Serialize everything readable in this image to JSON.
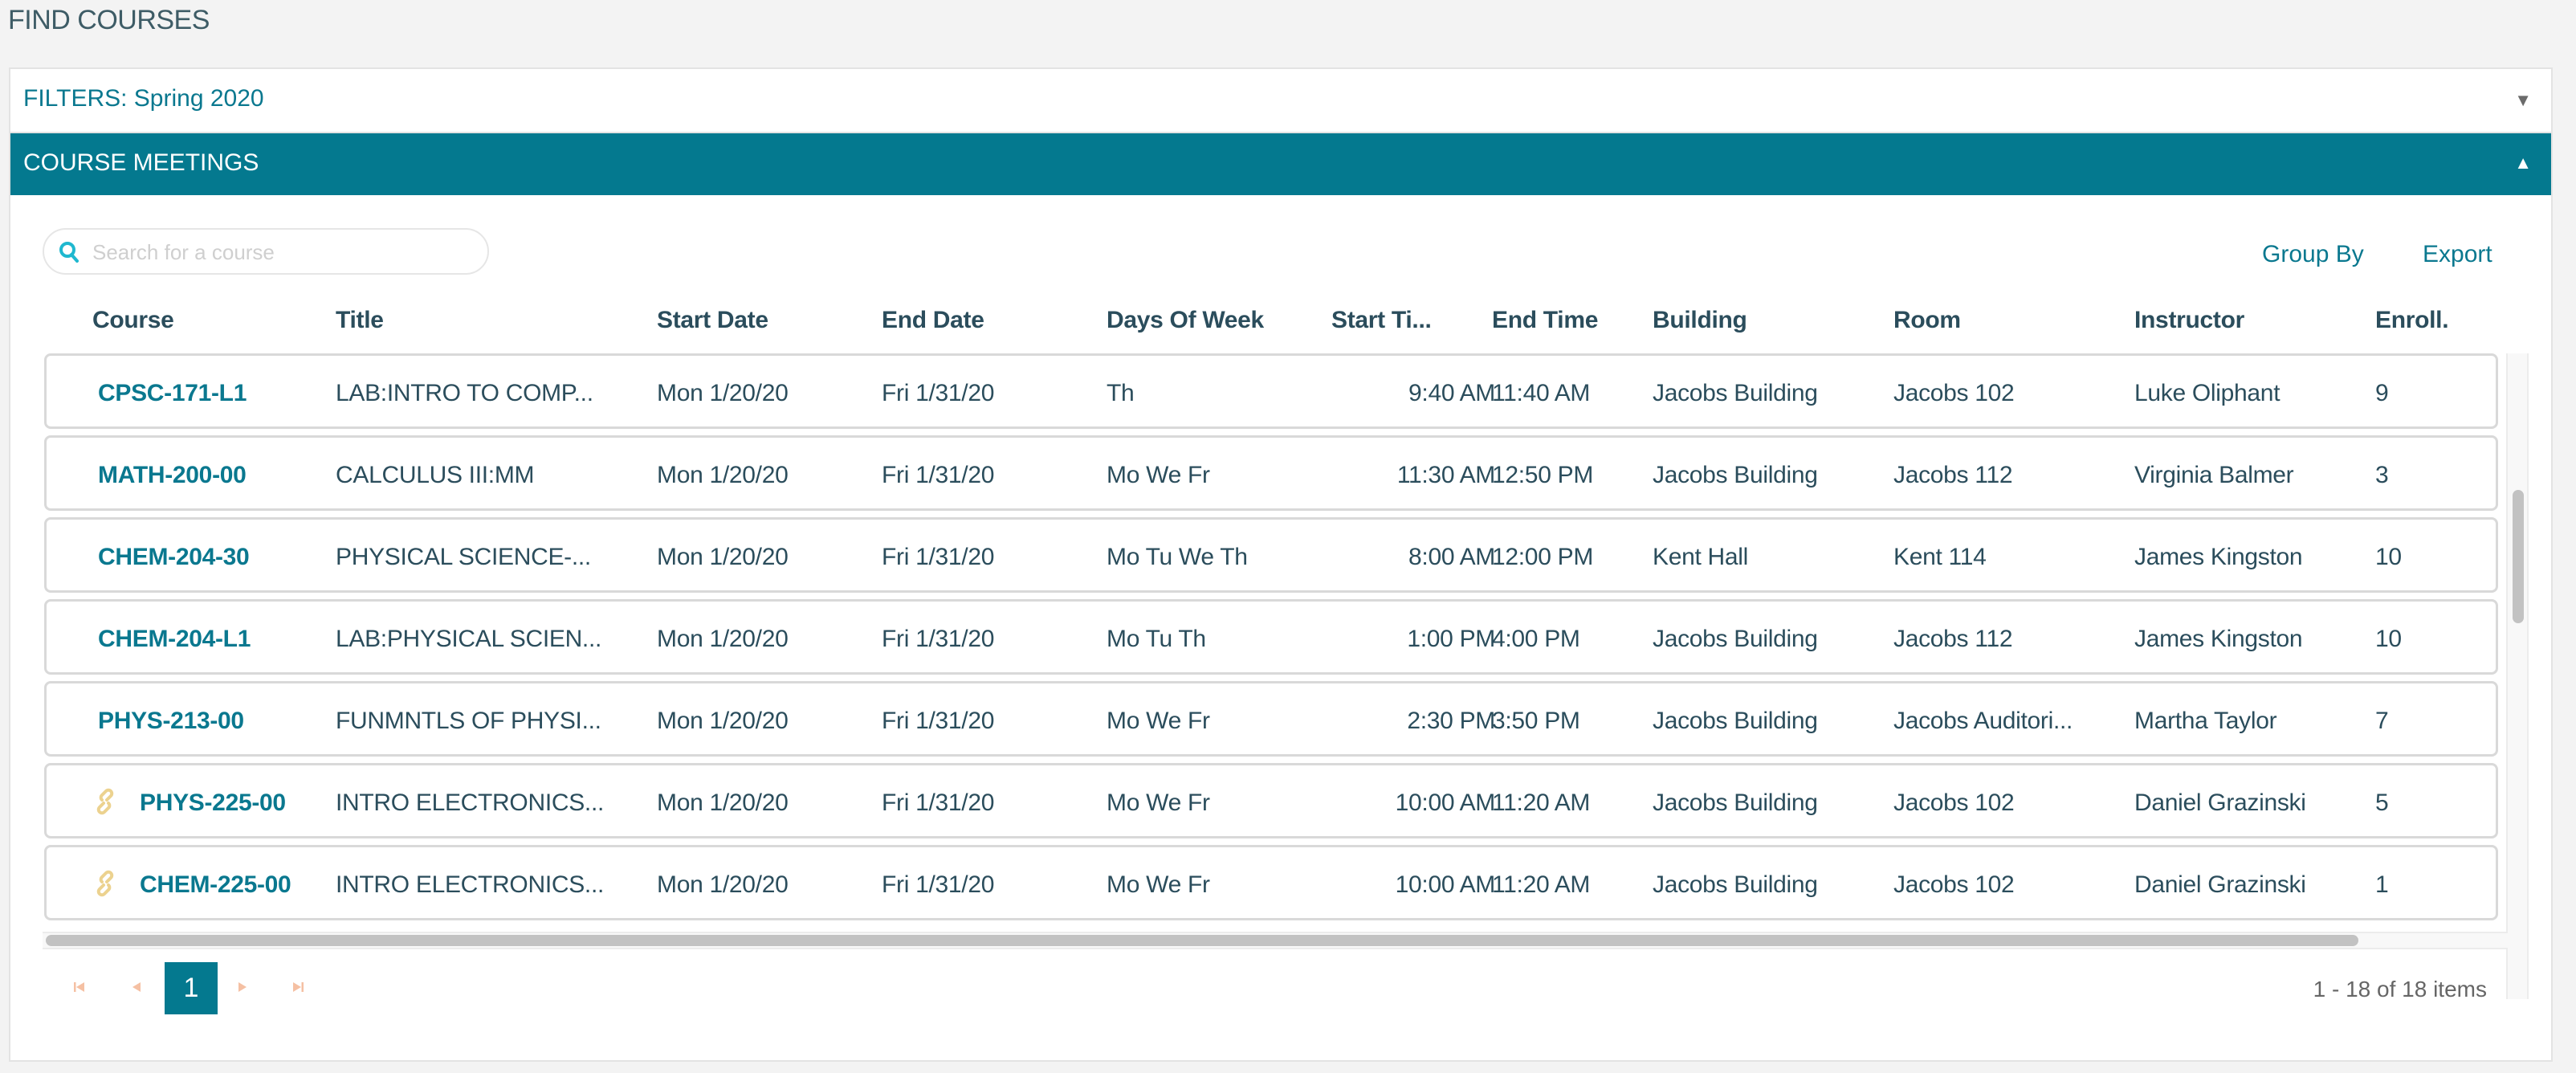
{
  "page": {
    "title": "FIND COURSES"
  },
  "filters": {
    "label": "FILTERS: Spring 2020",
    "icon": "caret-down-icon"
  },
  "meetings": {
    "label": "COURSE MEETINGS",
    "icon": "caret-up-icon"
  },
  "search": {
    "placeholder": "Search for a course",
    "value": "",
    "icon": "search-icon"
  },
  "toolbar": {
    "group_by_label": "Group By",
    "export_label": "Export"
  },
  "colors": {
    "accent": "#04798f",
    "link": "#0a788f",
    "text": "#2b4d5c",
    "linked_icon": "#ecd28f",
    "pager_disabled": "#f5c0a3"
  },
  "columns": [
    "Course",
    "Title",
    "Start Date",
    "End Date",
    "Days Of Week",
    "Start Ti...",
    "End Time",
    "Building",
    "Room",
    "Instructor",
    "Enroll."
  ],
  "rows": [
    {
      "course": "CPSC-171-L1",
      "linked": false,
      "title": "LAB:INTRO TO COMP...",
      "start_date": "Mon 1/20/20",
      "end_date": "Fri 1/31/20",
      "days": "Th",
      "start_time": "9:40 AM",
      "end_time": "11:40 AM",
      "building": "Jacobs Building",
      "room": "Jacobs 102",
      "instructor": "Luke Oliphant",
      "enroll": "9"
    },
    {
      "course": "MATH-200-00",
      "linked": false,
      "title": "CALCULUS III:MM",
      "start_date": "Mon 1/20/20",
      "end_date": "Fri 1/31/20",
      "days": "Mo We Fr",
      "start_time": "11:30 AM",
      "end_time": "12:50 PM",
      "building": "Jacobs Building",
      "room": "Jacobs 112",
      "instructor": "Virginia Balmer",
      "enroll": "3"
    },
    {
      "course": "CHEM-204-30",
      "linked": false,
      "title": "PHYSICAL SCIENCE-...",
      "start_date": "Mon 1/20/20",
      "end_date": "Fri 1/31/20",
      "days": "Mo Tu We Th",
      "start_time": "8:00 AM",
      "end_time": "12:00 PM",
      "building": "Kent Hall",
      "room": "Kent 114",
      "instructor": "James Kingston",
      "enroll": "10"
    },
    {
      "course": "CHEM-204-L1",
      "linked": false,
      "title": "LAB:PHYSICAL SCIEN...",
      "start_date": "Mon 1/20/20",
      "end_date": "Fri 1/31/20",
      "days": "Mo Tu Th",
      "start_time": "1:00 PM",
      "end_time": "4:00 PM",
      "building": "Jacobs Building",
      "room": "Jacobs 112",
      "instructor": "James Kingston",
      "enroll": "10"
    },
    {
      "course": "PHYS-213-00",
      "linked": false,
      "title": "FUNMNTLS OF PHYSI...",
      "start_date": "Mon 1/20/20",
      "end_date": "Fri 1/31/20",
      "days": "Mo We Fr",
      "start_time": "2:30 PM",
      "end_time": "3:50 PM",
      "building": "Jacobs Building",
      "room": "Jacobs Auditori...",
      "instructor": "Martha Taylor",
      "enroll": "7"
    },
    {
      "course": "PHYS-225-00",
      "linked": true,
      "title": "INTRO ELECTRONICS...",
      "start_date": "Mon 1/20/20",
      "end_date": "Fri 1/31/20",
      "days": "Mo We Fr",
      "start_time": "10:00 AM",
      "end_time": "11:20 AM",
      "building": "Jacobs Building",
      "room": "Jacobs 102",
      "instructor": "Daniel Grazinski",
      "enroll": "5"
    },
    {
      "course": "CHEM-225-00",
      "linked": true,
      "title": "INTRO ELECTRONICS...",
      "start_date": "Mon 1/20/20",
      "end_date": "Fri 1/31/20",
      "days": "Mo We Fr",
      "start_time": "10:00 AM",
      "end_time": "11:20 AM",
      "building": "Jacobs Building",
      "room": "Jacobs 102",
      "instructor": "Daniel Grazinski",
      "enroll": "1"
    }
  ],
  "pager": {
    "current_page": "1",
    "info": "1 - 18 of 18 items"
  }
}
